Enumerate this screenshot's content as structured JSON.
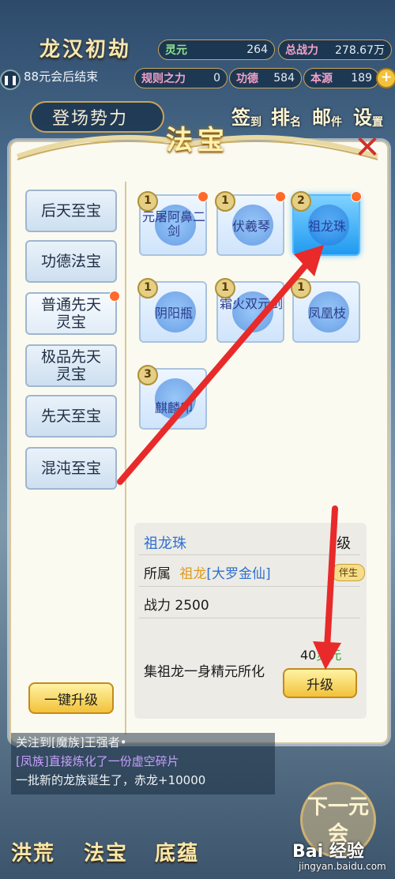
{
  "hud": {
    "title": "龙汉初劫",
    "subtitle": "88元会后结束",
    "stats": [
      {
        "k": "灵元",
        "v": "264"
      },
      {
        "k": "总战力",
        "v": "278.67万"
      },
      {
        "k": "规则之力",
        "v": "0"
      },
      {
        "k": "功德",
        "v": "584"
      },
      {
        "k": "本源",
        "v": "189"
      }
    ],
    "stage_label": "登场势力",
    "top_buttons": [
      {
        "big": "签",
        "small": "到"
      },
      {
        "big": "排",
        "small": "名"
      },
      {
        "big": "邮",
        "small": "件"
      },
      {
        "big": "设",
        "small": "置"
      }
    ]
  },
  "panel": {
    "title": "法宝",
    "close": "✕",
    "categories": [
      "后天至宝",
      "功德法宝",
      "普通先天灵宝",
      "极品先天灵宝",
      "先天至宝",
      "混沌至宝"
    ],
    "items": [
      {
        "name": "元屠阿鼻二剑",
        "level": "1"
      },
      {
        "name": "伏羲琴",
        "level": "1"
      },
      {
        "name": "祖龙珠",
        "level": "2"
      },
      {
        "name": "阴阳瓶",
        "level": "1"
      },
      {
        "name": "霜火双元剑",
        "level": "1"
      },
      {
        "name": "凤凰枝",
        "level": "1"
      },
      {
        "name": "麒麟印",
        "level": "3"
      }
    ],
    "one_key_upgrade": "一键升级"
  },
  "detail": {
    "name": "祖龙珠",
    "level_suffix": "级",
    "owner_label": "所属",
    "owner": "祖龙",
    "owner_rank": "[大罗金仙]",
    "companion": "伴生",
    "power_label": "战力",
    "power": "2500",
    "desc": "集祖龙一身精元所化",
    "cost": "40",
    "cost_unit": "灵元",
    "upgrade": "升级"
  },
  "log": [
    "关注到[魔族]王强者•",
    "[凤族]直接炼化了一份虚空碎片",
    "一批新的龙族诞生了，赤龙+10000"
  ],
  "bottom_nav": [
    "洪荒",
    "法宝",
    "底蕴"
  ],
  "next_label": "下一元会",
  "watermark": "Bai 经验",
  "watermark_url": "jingyan.baidu.com"
}
